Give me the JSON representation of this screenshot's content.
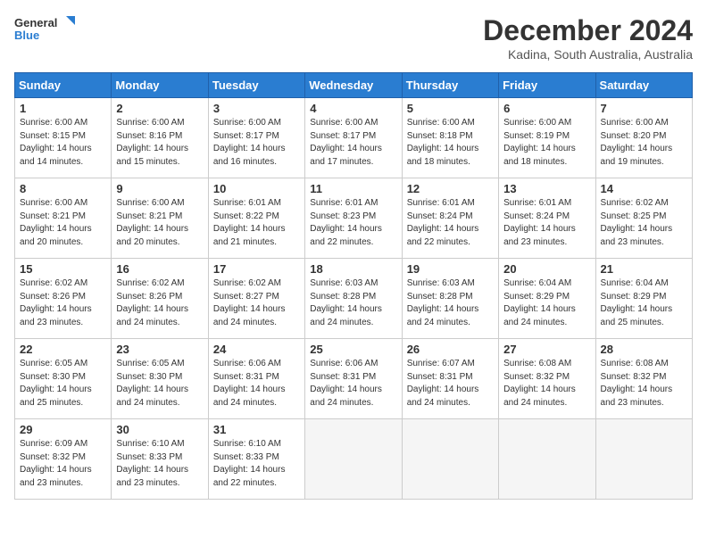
{
  "logo": {
    "line1": "General",
    "line2": "Blue"
  },
  "title": "December 2024",
  "subtitle": "Kadina, South Australia, Australia",
  "headers": [
    "Sunday",
    "Monday",
    "Tuesday",
    "Wednesday",
    "Thursday",
    "Friday",
    "Saturday"
  ],
  "weeks": [
    [
      {
        "day": "1",
        "info": "Sunrise: 6:00 AM\nSunset: 8:15 PM\nDaylight: 14 hours\nand 14 minutes."
      },
      {
        "day": "2",
        "info": "Sunrise: 6:00 AM\nSunset: 8:16 PM\nDaylight: 14 hours\nand 15 minutes."
      },
      {
        "day": "3",
        "info": "Sunrise: 6:00 AM\nSunset: 8:17 PM\nDaylight: 14 hours\nand 16 minutes."
      },
      {
        "day": "4",
        "info": "Sunrise: 6:00 AM\nSunset: 8:17 PM\nDaylight: 14 hours\nand 17 minutes."
      },
      {
        "day": "5",
        "info": "Sunrise: 6:00 AM\nSunset: 8:18 PM\nDaylight: 14 hours\nand 18 minutes."
      },
      {
        "day": "6",
        "info": "Sunrise: 6:00 AM\nSunset: 8:19 PM\nDaylight: 14 hours\nand 18 minutes."
      },
      {
        "day": "7",
        "info": "Sunrise: 6:00 AM\nSunset: 8:20 PM\nDaylight: 14 hours\nand 19 minutes."
      }
    ],
    [
      {
        "day": "8",
        "info": "Sunrise: 6:00 AM\nSunset: 8:21 PM\nDaylight: 14 hours\nand 20 minutes."
      },
      {
        "day": "9",
        "info": "Sunrise: 6:00 AM\nSunset: 8:21 PM\nDaylight: 14 hours\nand 20 minutes."
      },
      {
        "day": "10",
        "info": "Sunrise: 6:01 AM\nSunset: 8:22 PM\nDaylight: 14 hours\nand 21 minutes."
      },
      {
        "day": "11",
        "info": "Sunrise: 6:01 AM\nSunset: 8:23 PM\nDaylight: 14 hours\nand 22 minutes."
      },
      {
        "day": "12",
        "info": "Sunrise: 6:01 AM\nSunset: 8:24 PM\nDaylight: 14 hours\nand 22 minutes."
      },
      {
        "day": "13",
        "info": "Sunrise: 6:01 AM\nSunset: 8:24 PM\nDaylight: 14 hours\nand 23 minutes."
      },
      {
        "day": "14",
        "info": "Sunrise: 6:02 AM\nSunset: 8:25 PM\nDaylight: 14 hours\nand 23 minutes."
      }
    ],
    [
      {
        "day": "15",
        "info": "Sunrise: 6:02 AM\nSunset: 8:26 PM\nDaylight: 14 hours\nand 23 minutes."
      },
      {
        "day": "16",
        "info": "Sunrise: 6:02 AM\nSunset: 8:26 PM\nDaylight: 14 hours\nand 24 minutes."
      },
      {
        "day": "17",
        "info": "Sunrise: 6:02 AM\nSunset: 8:27 PM\nDaylight: 14 hours\nand 24 minutes."
      },
      {
        "day": "18",
        "info": "Sunrise: 6:03 AM\nSunset: 8:28 PM\nDaylight: 14 hours\nand 24 minutes."
      },
      {
        "day": "19",
        "info": "Sunrise: 6:03 AM\nSunset: 8:28 PM\nDaylight: 14 hours\nand 24 minutes."
      },
      {
        "day": "20",
        "info": "Sunrise: 6:04 AM\nSunset: 8:29 PM\nDaylight: 14 hours\nand 24 minutes."
      },
      {
        "day": "21",
        "info": "Sunrise: 6:04 AM\nSunset: 8:29 PM\nDaylight: 14 hours\nand 25 minutes."
      }
    ],
    [
      {
        "day": "22",
        "info": "Sunrise: 6:05 AM\nSunset: 8:30 PM\nDaylight: 14 hours\nand 25 minutes."
      },
      {
        "day": "23",
        "info": "Sunrise: 6:05 AM\nSunset: 8:30 PM\nDaylight: 14 hours\nand 24 minutes."
      },
      {
        "day": "24",
        "info": "Sunrise: 6:06 AM\nSunset: 8:31 PM\nDaylight: 14 hours\nand 24 minutes."
      },
      {
        "day": "25",
        "info": "Sunrise: 6:06 AM\nSunset: 8:31 PM\nDaylight: 14 hours\nand 24 minutes."
      },
      {
        "day": "26",
        "info": "Sunrise: 6:07 AM\nSunset: 8:31 PM\nDaylight: 14 hours\nand 24 minutes."
      },
      {
        "day": "27",
        "info": "Sunrise: 6:08 AM\nSunset: 8:32 PM\nDaylight: 14 hours\nand 24 minutes."
      },
      {
        "day": "28",
        "info": "Sunrise: 6:08 AM\nSunset: 8:32 PM\nDaylight: 14 hours\nand 23 minutes."
      }
    ],
    [
      {
        "day": "29",
        "info": "Sunrise: 6:09 AM\nSunset: 8:32 PM\nDaylight: 14 hours\nand 23 minutes."
      },
      {
        "day": "30",
        "info": "Sunrise: 6:10 AM\nSunset: 8:33 PM\nDaylight: 14 hours\nand 23 minutes."
      },
      {
        "day": "31",
        "info": "Sunrise: 6:10 AM\nSunset: 8:33 PM\nDaylight: 14 hours\nand 22 minutes."
      },
      null,
      null,
      null,
      null
    ]
  ]
}
